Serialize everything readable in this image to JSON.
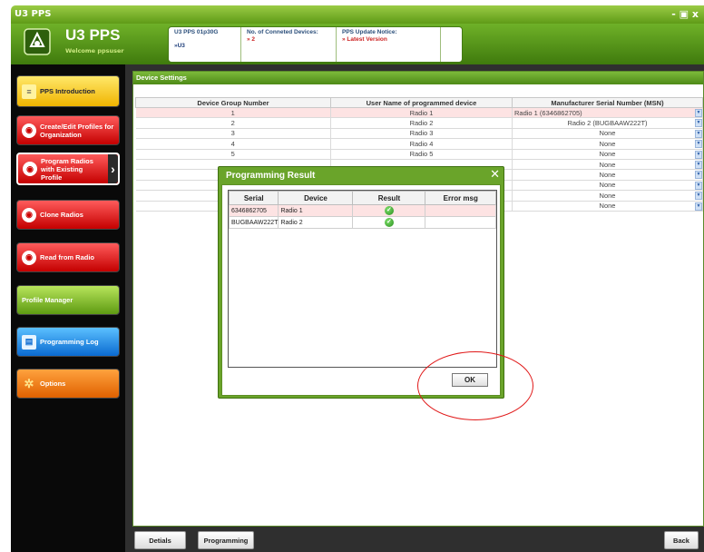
{
  "window": {
    "title": "U3 PPS",
    "controls": "- ▣ x"
  },
  "header": {
    "app_name": "U3 PPS",
    "welcome": "Welcome ppsuser",
    "info": [
      {
        "label": "U3 PPS 01p30G",
        "value": "»U3"
      },
      {
        "label": "No. of Conneted Devices:",
        "value": "» 2"
      },
      {
        "label": "PPS Update Notice:",
        "value": "» Latest Version"
      }
    ]
  },
  "sidebar": {
    "items": [
      {
        "label": "PPS Introduction",
        "icon": "document-icon",
        "color": "yellow"
      },
      {
        "label": "Create/Edit Profiles for Organization",
        "icon": "radio-icon",
        "color": "red"
      },
      {
        "label": "Program Radios with Existing Profile",
        "icon": "radio-icon",
        "color": "red"
      },
      {
        "label": "Clone Radios",
        "icon": "radio-icon",
        "color": "red"
      },
      {
        "label": "Read from Radio",
        "icon": "radio-icon",
        "color": "red"
      },
      {
        "label": "Profile Manager",
        "icon": "",
        "color": "green"
      },
      {
        "label": "Programming Log",
        "icon": "log-icon",
        "color": "blue"
      },
      {
        "label": "Options",
        "icon": "gear-icon",
        "color": "orange"
      }
    ]
  },
  "main": {
    "panel_title": "Device Settings",
    "columns": [
      "Device Group Number",
      "User Name of programmed device",
      "Manufacturer Serial Number (MSN)"
    ],
    "rows": [
      {
        "group": "1",
        "name": "Radio 1",
        "msn": "Radio 1 (6346862705)"
      },
      {
        "group": "2",
        "name": "Radio 2",
        "msn": "Radio 2 (BUGBAAW222T)"
      },
      {
        "group": "3",
        "name": "Radio 3",
        "msn": "None"
      },
      {
        "group": "4",
        "name": "Radio 4",
        "msn": "None"
      },
      {
        "group": "5",
        "name": "Radio 5",
        "msn": "None"
      },
      {
        "group": "",
        "name": "",
        "msn": "None"
      },
      {
        "group": "",
        "name": "",
        "msn": "None"
      },
      {
        "group": "",
        "name": "",
        "msn": "None"
      },
      {
        "group": "",
        "name": "",
        "msn": "None"
      },
      {
        "group": "",
        "name": "",
        "msn": "None"
      }
    ]
  },
  "bottom": {
    "details": "Detials",
    "programming": "Programming",
    "back": "Back"
  },
  "modal": {
    "title": "Programming Result",
    "columns": [
      "Serial",
      "Device",
      "Result",
      "Error msg"
    ],
    "rows": [
      {
        "serial": "6346862705",
        "device": "Radio 1",
        "error": ""
      },
      {
        "serial": "BUGBAAW222T",
        "device": "Radio 2",
        "error": ""
      }
    ],
    "ok": "OK"
  },
  "colors": {
    "accent_green": "#6aa42a",
    "highlight": "#e01818"
  }
}
